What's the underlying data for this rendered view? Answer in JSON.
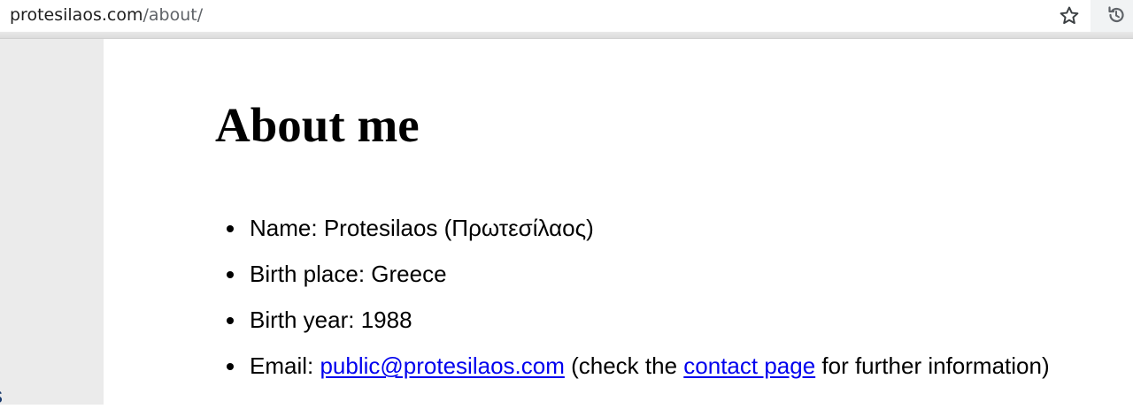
{
  "browser": {
    "url_host": "protesilaos.com",
    "url_path": "/about/",
    "star_icon": "star-icon",
    "history_icon": "history-icon"
  },
  "sidebar": {
    "fragment_text": "s"
  },
  "page": {
    "title": "About me",
    "items": [
      {
        "label": "Name: ",
        "value": "Protesilaos (Πρωτεσίλαος)"
      },
      {
        "label": "Birth place: ",
        "value": "Greece"
      },
      {
        "label": "Birth year: ",
        "value": "1988"
      },
      {
        "label": "Email: ",
        "email_link": "public@protesilaos.com",
        "text_before_link": " (check the ",
        "contact_link": "contact page",
        "text_after_link": " for further information)"
      }
    ]
  },
  "colors": {
    "link": "#0000ee",
    "sidebar_bg": "#ebebeb"
  }
}
